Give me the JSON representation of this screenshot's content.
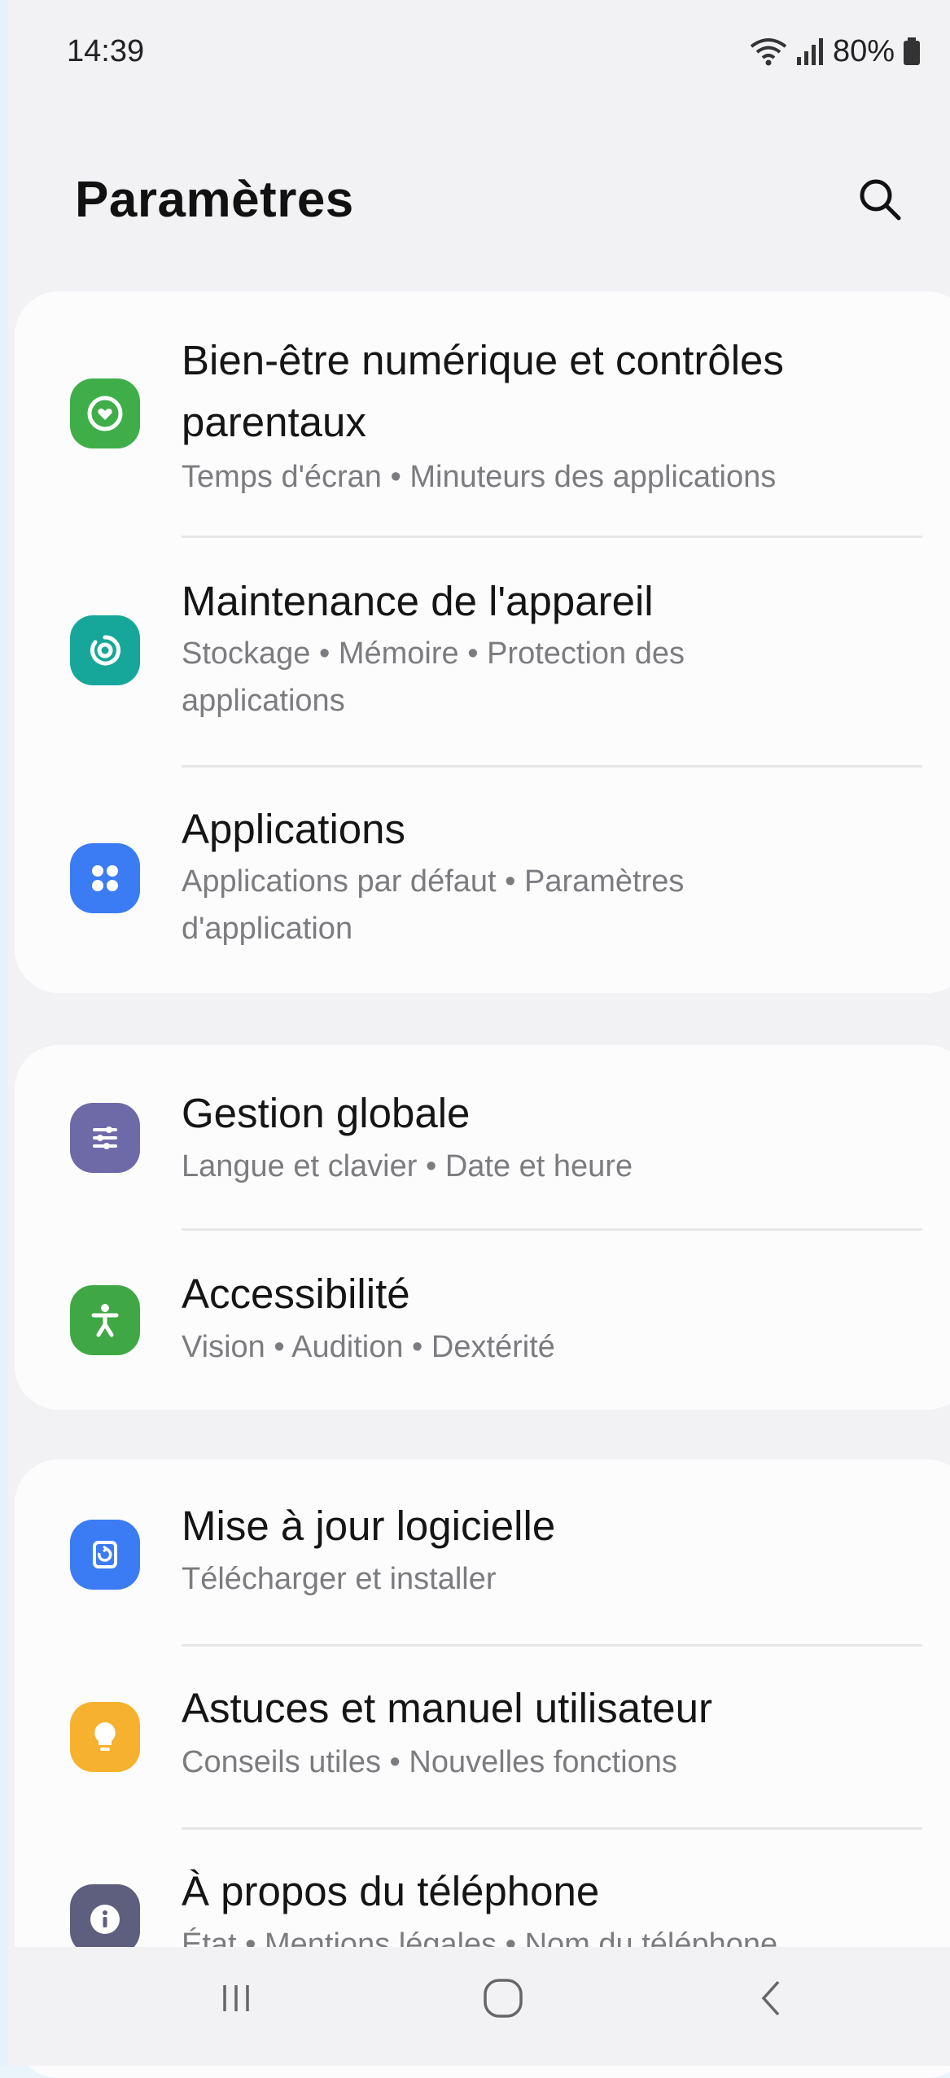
{
  "status_bar": {
    "time": "14:39",
    "battery": "80%"
  },
  "header": {
    "title": "Paramètres",
    "search_icon": "search-icon"
  },
  "groups": [
    {
      "items": [
        {
          "title_line1": "Bien-être numérique et contrôles",
          "title_line2": "parentaux",
          "subtitle": "Temps d'écran • Minuteurs des applications",
          "icon": "digital-wellbeing-icon",
          "color": "#3fae49"
        },
        {
          "title_line1": "Maintenance de l'appareil",
          "subtitle_line1": "Stockage • Mémoire • Protection des",
          "subtitle_line2": "applications",
          "icon": "device-care-icon",
          "color": "#17a79a"
        },
        {
          "title_line1": "Applications",
          "subtitle_line1": "Applications par défaut • Paramètres",
          "subtitle_line2": "d'application",
          "icon": "apps-icon",
          "color": "#3b7cf5"
        }
      ]
    },
    {
      "items": [
        {
          "title_line1": "Gestion globale",
          "subtitle": "Langue et clavier • Date et heure",
          "icon": "general-management-icon",
          "color": "#6e6aa8"
        },
        {
          "title_line1": "Accessibilité",
          "subtitle": "Vision • Audition • Dextérité",
          "icon": "accessibility-icon",
          "color": "#3fa845"
        }
      ]
    },
    {
      "items": [
        {
          "title_line1": "Mise à jour logicielle",
          "subtitle": "Télécharger et installer",
          "icon": "software-update-icon",
          "color": "#3b7cf5"
        },
        {
          "title_line1": "Astuces et manuel utilisateur",
          "subtitle": "Conseils utiles • Nouvelles fonctions",
          "icon": "tips-bulb-icon",
          "color": "#f6b22f"
        },
        {
          "title_line1": "À propos du téléphone",
          "subtitle": "État • Mentions légales • Nom du téléphone",
          "icon": "info-icon",
          "color": "#5e5f7e"
        }
      ]
    }
  ],
  "nav_bar": {
    "recents_icon": "recents-icon",
    "home_icon": "home-icon",
    "back_icon": "back-icon"
  }
}
